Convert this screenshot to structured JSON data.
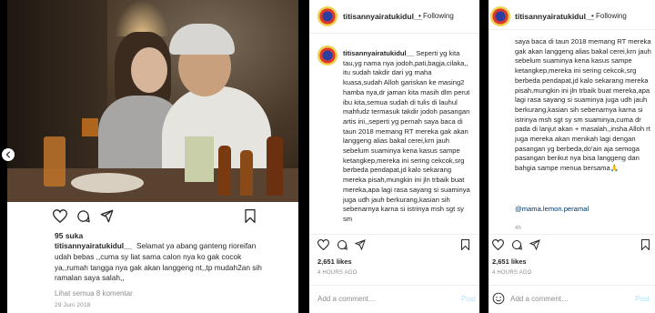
{
  "post1": {
    "likes": "95 suka",
    "username": "titisannyairatukidul__",
    "caption": "Selamat ya abang ganteng rioreifan udah bebas ,,cuma sy liat sama calon nya ko gak cocok ya,,rumah tangga nya gak akan langgeng nt,,tp mudah2an sih ramalan saya salah,,",
    "view_all": "Lihat semua 8 komentar",
    "date": "29 Juni 2018"
  },
  "post2": {
    "username": "titisannyairatukidul__",
    "follow": "Following",
    "body": "Seperti yg kita tau,yg nama nya jodoh,pati,bagja,cilaka,, itu sudah takdir dari yg maha kuasa,sudah Alloh gariskan ke masing2 hamba nya,dr jaman kita masih dlm perut ibu kita,semua sudah di tulis di lauhul mahfudz termasuk takdir jodoh pasangan artis ini,,seperti yg pernah saya baca di taun 2018 memang RT mereka gak akan langgeng alias bakal cerei,krn jauh sebelum suaminya kena kasus sampe ketangkep,mereka ini sering cekcok,srg berbeda pendapat,jd kalo sekarang mereka pisah,mungkin ini jln trbaik buat mereka,apa lagi rasa sayang si suaminya juga udh jauh berkurang,kasian sih sebenarnya karna si istrinya msh sgt sy sm",
    "likes": "2,651 likes",
    "time": "4 HOURS AGO",
    "comment_placeholder": "Add a comment…",
    "post_label": "Post"
  },
  "post3": {
    "username": "titisannyairatukidul__",
    "follow": "Following",
    "body_top": "saya baca di taun 2018 memang RT mereka gak akan langgeng alias bakal cerei,krn jauh sebelum suaminya kena kasus sampe ketangkep,mereka ini sering cekcok,srg berbeda pendapat,jd kalo sekarang mereka pisah,mungkin ini jln trbaik buat mereka,apa lagi rasa sayang si suaminya juga udh jauh berkurang,kasian sih sebenarnya karna si istrinya msh sgt sy sm suaminya,cuma dr pada di lanjut akan + masalah,,insha Alloh rt juga mereka akan menikah lagi dengan pasangan yg berbeda,do'ain aja semoga pasangan berikut nya bisa langgeng dan bahgia sampe menua bersama",
    "emoji": "🙏",
    "mention": "@mama.lemon.peramal",
    "reply_time": "4h",
    "likes": "2,651 likes",
    "time": "4 HOURS AGO",
    "comment_placeholder": "Add a comment…",
    "post_label": "Post"
  },
  "icons": [
    "heart-icon",
    "comment-icon",
    "share-icon",
    "bookmark-icon",
    "more-icon",
    "chevron-left-icon",
    "smile-icon"
  ]
}
